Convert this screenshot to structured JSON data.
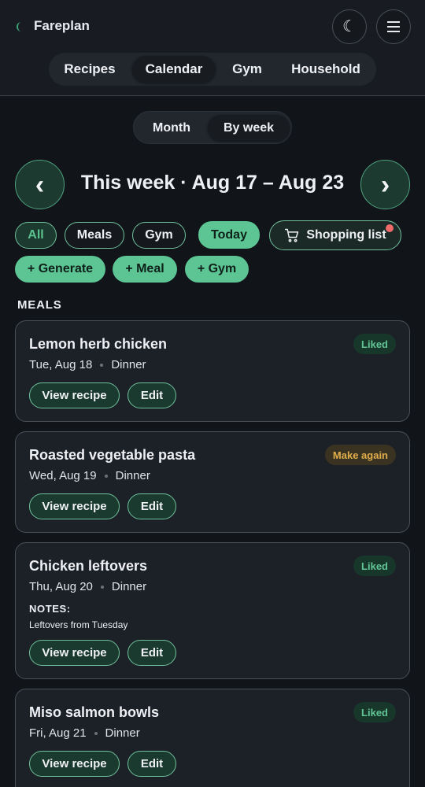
{
  "app": {
    "title": "Fareplan",
    "theme_icon": "moon-icon",
    "menu_icon": "hamburger-menu-icon"
  },
  "nav": {
    "tabs": [
      {
        "label": "Recipes",
        "active": false
      },
      {
        "label": "Calendar",
        "active": true
      },
      {
        "label": "Gym",
        "active": false
      },
      {
        "label": "Household",
        "active": false
      }
    ]
  },
  "view": {
    "options": [
      {
        "label": "Month",
        "active": false
      },
      {
        "label": "By week",
        "active": true
      }
    ]
  },
  "week": {
    "title": "This week · Aug 17 – Aug 23",
    "prev_icon": "chevron-left-icon",
    "next_icon": "chevron-right-icon"
  },
  "filters": {
    "all": "All",
    "meals": "Meals",
    "gym": "Gym",
    "today": "Today",
    "shopping": "Shopping list",
    "shopping_has_badge": true
  },
  "actions": {
    "generate": "+ Generate",
    "meal": "+ Meal",
    "gym": "+ Gym"
  },
  "meals": {
    "section_label": "MEALS",
    "items": [
      {
        "title": "Lemon herb chicken",
        "date": "Tue, Aug 18",
        "type": "Dinner",
        "status": "Liked",
        "notes_label": "",
        "notes": "",
        "view": "View recipe",
        "edit": "Edit"
      },
      {
        "title": "Roasted vegetable pasta",
        "date": "Wed, Aug 19",
        "type": "Dinner",
        "status": "Make again",
        "notes_label": "",
        "notes": "",
        "view": "View recipe",
        "edit": "Edit"
      },
      {
        "title": "Chicken leftovers",
        "date": "Thu, Aug 20",
        "type": "Dinner",
        "status": "Liked",
        "notes_label": "NOTES:",
        "notes": "Leftovers from Tuesday",
        "view": "View recipe",
        "edit": "Edit"
      },
      {
        "title": "Miso salmon bowls",
        "date": "Fri, Aug 21",
        "type": "Dinner",
        "status": "Liked",
        "notes_label": "",
        "notes": "",
        "view": "View recipe",
        "edit": "Edit"
      }
    ]
  },
  "colors": {
    "accent": "#5cc593",
    "background": "#111419",
    "card": "#1c2027",
    "liked": "#62c596",
    "make_again": "#e0ad4a",
    "badge": "#f06a6a"
  }
}
